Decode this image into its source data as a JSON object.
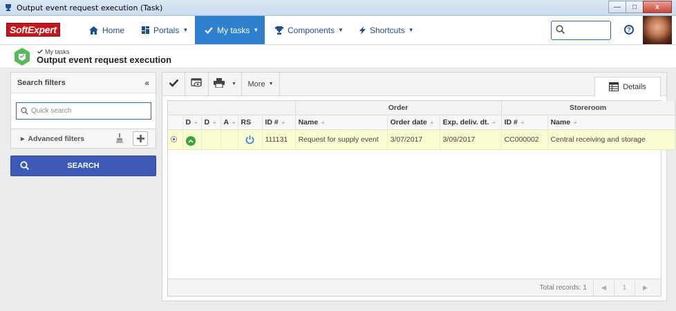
{
  "window": {
    "title": "Output event request execution (Task)",
    "buttons": {
      "minimize": "—",
      "maximize": "□",
      "close": "x"
    }
  },
  "topnav": {
    "logo_text": "SoftExpert",
    "items": [
      {
        "label": "Home",
        "icon": "home-icon"
      },
      {
        "label": "Portals",
        "icon": "portals-icon"
      },
      {
        "label": "My tasks",
        "icon": "check-icon"
      },
      {
        "label": "Components",
        "icon": "trophy-icon"
      },
      {
        "label": "Shortcuts",
        "icon": "lightning-icon"
      }
    ],
    "help_label": "?"
  },
  "page": {
    "breadcrumb": "My tasks",
    "title": "Output event request execution"
  },
  "filters": {
    "title": "Search filters",
    "quick_search_placeholder": "Quick search",
    "advanced_label": "Advanced filters",
    "search_button": "SEARCH"
  },
  "toolbar": {
    "more_label": "More",
    "details_tab": "Details"
  },
  "grid": {
    "groups": {
      "order": "Order",
      "storeroom": "Storeroom"
    },
    "columns": [
      "D",
      "D",
      "A",
      "RS",
      "ID #",
      "Name",
      "Order date",
      "Exp. deliv. dt.",
      "ID #",
      "Name"
    ],
    "rows": [
      {
        "order_id": "111131",
        "order_name": "Request for supply event",
        "order_date": "3/07/2017",
        "exp_delivery": "3/09/2017",
        "storeroom_id": "CC000002",
        "storeroom_name": "Central receiving and storage"
      }
    ],
    "footer": {
      "total_records": "Total records: 1",
      "page": "1"
    }
  },
  "colors": {
    "accent": "#2f80cf",
    "search_button": "#3d5ab8",
    "row_highlight": "#fbfbd1",
    "logo_red": "#c4161c"
  }
}
